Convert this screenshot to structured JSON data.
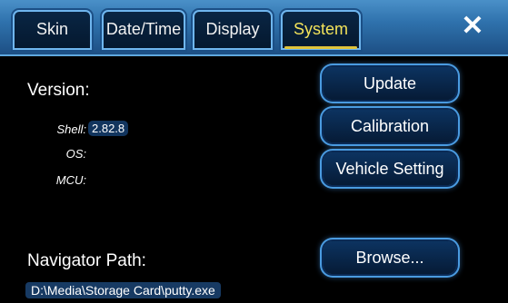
{
  "tabs": [
    {
      "label": "Skin"
    },
    {
      "label": "Date/Time"
    },
    {
      "label": "Display"
    },
    {
      "label": "System"
    }
  ],
  "active_tab": "System",
  "close_label": "✕",
  "version": {
    "heading": "Version:",
    "shell_label": "Shell:",
    "shell_value": "2.82.8",
    "os_label": "OS:",
    "mcu_label": "MCU:"
  },
  "buttons": {
    "update": "Update",
    "calibration": "Calibration",
    "vehicle_setting": "Vehicle Setting",
    "browse": "Browse..."
  },
  "navigator": {
    "heading": "Navigator Path:",
    "path": "D:\\Media\\Storage Card\\putty.exe"
  },
  "colors": {
    "active_tab_text": "#f3e35a",
    "accent_blue": "#4a9be0"
  }
}
